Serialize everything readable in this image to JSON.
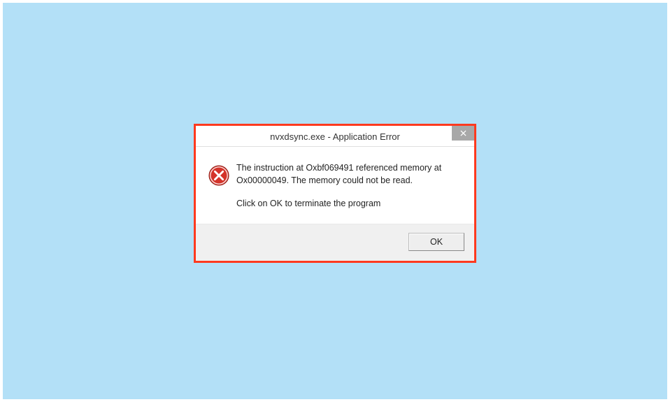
{
  "dialog": {
    "title": "nvxdsync.exe - Application Error",
    "message_line1": "The instruction at Oxbf069491 referenced memory at Ox00000049. The memory could not be read.",
    "message_line2": "Click on OK to terminate the program",
    "ok_label": "OK"
  }
}
